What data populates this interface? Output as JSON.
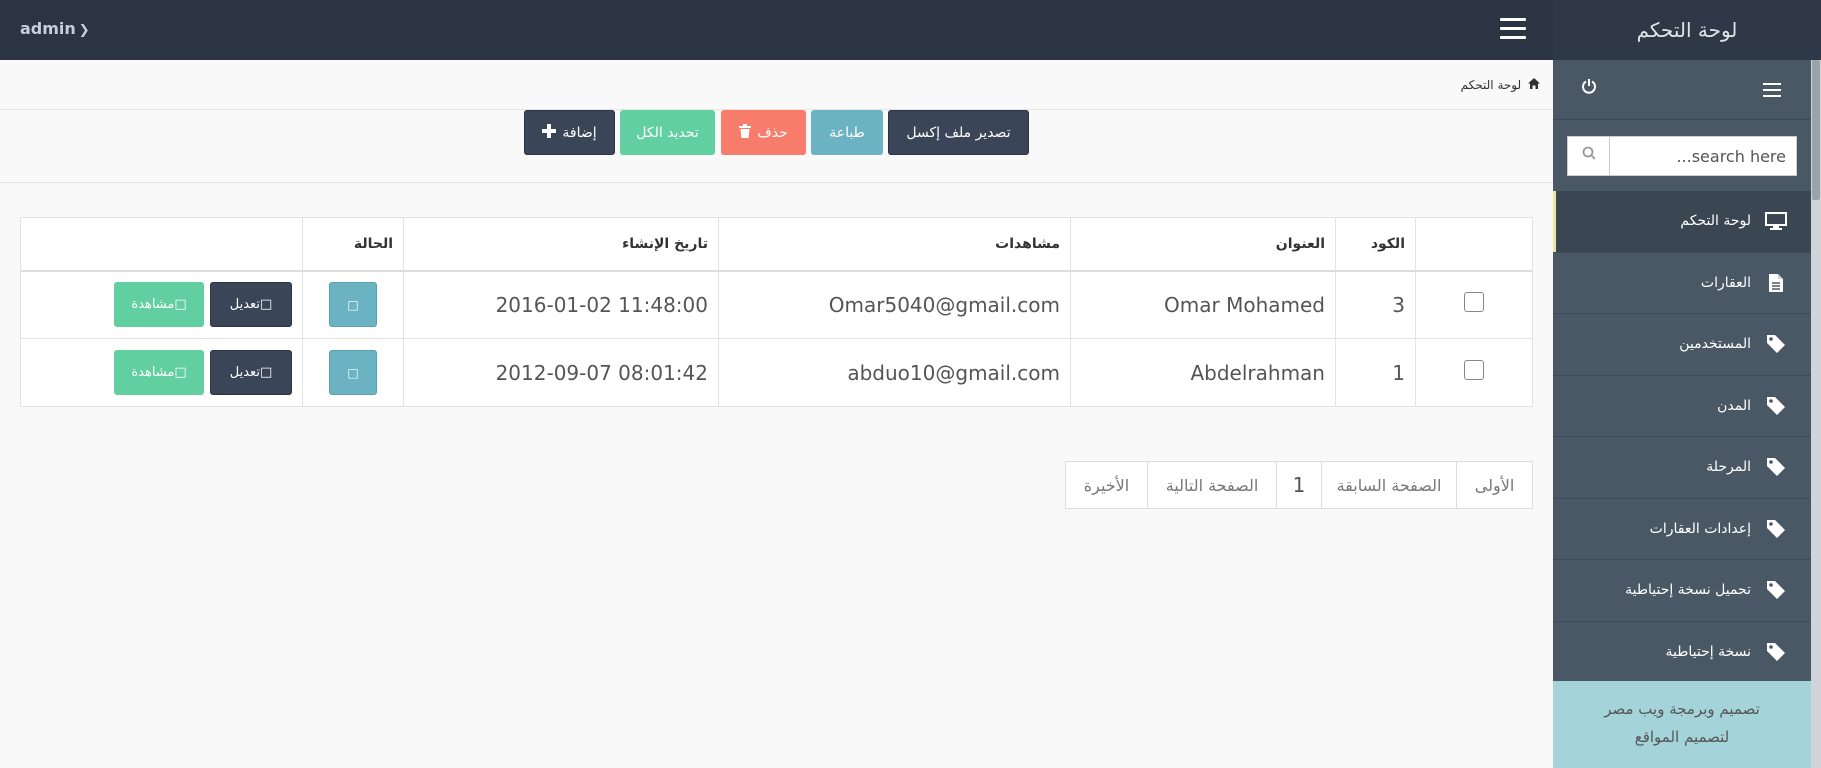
{
  "topbar": {
    "brand": "لوحة التحكم",
    "user": "admin"
  },
  "sidebar": {
    "search_placeholder": "...search here",
    "items": [
      {
        "label": "لوحة التحكم",
        "icon": "monitor-icon"
      },
      {
        "label": "العقارات",
        "icon": "document-icon"
      },
      {
        "label": "المستخدمين",
        "icon": "tag-icon"
      },
      {
        "label": "المدن",
        "icon": "tag-icon"
      },
      {
        "label": "المرحلة",
        "icon": "tag-icon"
      },
      {
        "label": "إعدادات العقارات",
        "icon": "tag-icon"
      },
      {
        "label": "تحميل نسخة إحتياطية",
        "icon": "tag-icon"
      },
      {
        "label": "نسخة إحتياطية",
        "icon": "tag-icon"
      }
    ],
    "footer_line1": "تصميم وبرمجة ويب مصر",
    "footer_line2": "لتصميم المواقع"
  },
  "breadcrumb": {
    "label": "لوحة التحكم"
  },
  "toolbar": {
    "export": "تصدير ملف إكسل",
    "print": "طباعة",
    "delete": "حذف",
    "select_all": "تحديد الكل",
    "add": "إضافة"
  },
  "table": {
    "headers": {
      "code": "الكود",
      "title": "العنوان",
      "views": "مشاهدات",
      "created": "تاريخ الإنشاء",
      "status": "الحالة"
    },
    "rows": [
      {
        "code": "3",
        "title": "Omar Mohamed",
        "views": "Omar5040@gmail.com",
        "created": "2016-01-02 11:48:00",
        "edit": "تعديل",
        "view": "مشاهدة"
      },
      {
        "code": "1",
        "title": "Abdelrahman",
        "views": "abduo10@gmail.com",
        "created": "2012-09-07 08:01:42",
        "edit": "تعديل",
        "view": "مشاهدة"
      }
    ]
  },
  "pagination": {
    "first": "الأولى",
    "prev": "الصفحة السابقة",
    "page": "1",
    "next": "الصفحة التالية",
    "last": "الأخيرة"
  },
  "colors": {
    "topbar": "#2a3442",
    "sidebar": "#4a5866",
    "dark_button": "#3a4658",
    "info": "#6bb3c3",
    "danger": "#f87c6c",
    "success": "#62cfa0",
    "footer": "#a4d4d9"
  }
}
